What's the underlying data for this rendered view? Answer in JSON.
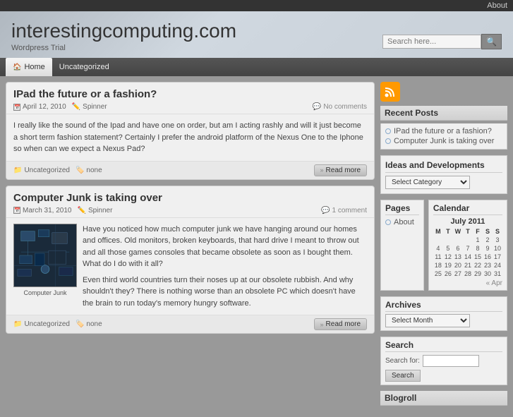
{
  "topbar": {
    "about_link": "About"
  },
  "header": {
    "site_title": "interestingcomputing.com",
    "site_subtitle": "Wordpress Trial",
    "search_placeholder": "Search here...",
    "search_button_label": "🔍"
  },
  "nav": {
    "items": [
      {
        "label": "Home",
        "active": true
      },
      {
        "label": "Uncategorized",
        "active": false
      }
    ]
  },
  "posts": [
    {
      "id": 1,
      "title": "IPad the future or a fashion?",
      "date": "April 12, 2010",
      "author": "Spinner",
      "comments": "No comments",
      "body": "I really like the sound of the Ipad and have one on order, but am I acting rashly and will it just become a short term fashion statement? Certainly I prefer the android platform of the Nexus One to the Iphone so when can we expect a Nexus Pad?",
      "has_image": false,
      "category": "Uncategorized",
      "tags": "none",
      "read_more": "Read more"
    },
    {
      "id": 2,
      "title": "Computer Junk is taking over",
      "date": "March 31, 2010",
      "author": "Spinner",
      "comments": "1 comment",
      "body1": "Have you noticed how much computer junk we have hanging around our homes and offices. Old monitors, broken keyboards, that hard drive I meant to throw out and all those games consoles that became obsolete as soon as I bought them. What do I do with it all?",
      "body2": "Even third world countries turn their noses up at our obsolete rubbish. And why shouldn't they? There is nothing worse than an obsolete PC which doesn't have the brain to run today's memory hungry software.",
      "has_image": true,
      "image_caption": "Computer Junk",
      "category": "Uncategorized",
      "tags": "none",
      "read_more": "Read more"
    }
  ],
  "sidebar": {
    "recent_posts_title": "Recent Posts",
    "recent_posts": [
      {
        "label": "IPad the future or a fashion?"
      },
      {
        "label": "Computer Junk is taking over"
      }
    ],
    "ideas_title": "Ideas and Developments",
    "select_category_label": "Select Category",
    "pages_title": "Pages",
    "pages_links": [
      {
        "label": "About"
      }
    ],
    "calendar_title": "Calendar",
    "calendar_month": "July 2011",
    "calendar_days_header": [
      "M",
      "T",
      "W",
      "T",
      "F",
      "S",
      "S"
    ],
    "calendar_rows": [
      [
        "",
        "",
        "",
        "",
        "1",
        "2",
        "3"
      ],
      [
        "4",
        "5",
        "6",
        "7",
        "8",
        "9",
        "10"
      ],
      [
        "11",
        "12",
        "13",
        "14",
        "15",
        "16",
        "17"
      ],
      [
        "18",
        "19",
        "20",
        "21",
        "22",
        "23",
        "24"
      ],
      [
        "25",
        "26",
        "27",
        "28",
        "29",
        "30",
        "31"
      ]
    ],
    "calendar_nav": "« Apr",
    "archives_title": "Archives",
    "select_month_label": "Select Month",
    "search_title": "Search",
    "search_for_label": "Search for:",
    "search_button_label": "Search",
    "blogroll_title": "Blogroll"
  }
}
